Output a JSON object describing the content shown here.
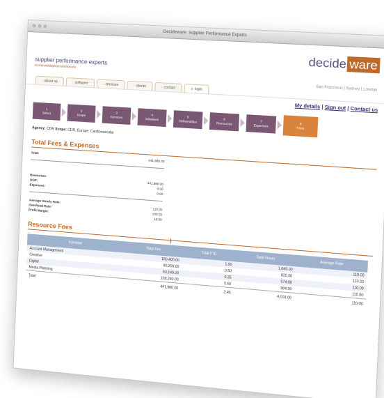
{
  "window": {
    "title": "Decideware: Supplier Performance Experts"
  },
  "brand": {
    "tagline": "supplier performance experts",
    "subtagline": "scorecard/deployment/service"
  },
  "logo": {
    "part1": "decide",
    "part2": "ware"
  },
  "cities": "San Francisco | Sydney | London",
  "nav": [
    {
      "label": "about us"
    },
    {
      "label": "software"
    },
    {
      "label": "services"
    },
    {
      "label": "clients"
    },
    {
      "label": "contact"
    },
    {
      "label": "login"
    }
  ],
  "user_links": {
    "details": "My details",
    "signout": "Sign out",
    "contact": "Contact us",
    "sep": "|"
  },
  "steps": [
    {
      "num": "1",
      "label": "Select"
    },
    {
      "num": "2",
      "label": "Scope"
    },
    {
      "num": "3",
      "label": "Services"
    },
    {
      "num": "4",
      "label": "Initiatives"
    },
    {
      "num": "5",
      "label": "Deliverables"
    },
    {
      "num": "6",
      "label": "Resources"
    },
    {
      "num": "7",
      "label": "Expenses"
    },
    {
      "num": "8",
      "label": "Fees"
    }
  ],
  "agency": {
    "agency_label": "Agency:",
    "agency": "CDR",
    "scope_label": "Scope:",
    "scope": "CDR, Europe, Cardiovascular"
  },
  "fees": {
    "heading": "Total Fees & Expenses",
    "total_label": "Total:",
    "total": "441,980.00",
    "resources_label": "Resources:",
    "resources": "441,980.00",
    "oop_label": "OOP:",
    "oop": "0.00",
    "expenses_label": "Expenses:",
    "expenses": "0.00",
    "avg_rate_label": "Average Hourly Rate:",
    "avg_rate": "110.00",
    "overhead_label": "Overhead Rate:",
    "overhead": "100.00",
    "margin_label": "Profit Margin:",
    "margin": "15.00"
  },
  "resource_fees": {
    "heading": "Resource Fees",
    "columns": [
      "Function",
      "Total Fee",
      "Total FTE",
      "Total Hours",
      "Average Rate"
    ],
    "rows": [
      [
        "Account Management",
        "180,400.00",
        "1.00",
        "1,640.00",
        "110.00"
      ],
      [
        "Creative",
        "90,200.00",
        "0.50",
        "820.00",
        "110.00"
      ],
      [
        "Digital",
        "63,140.00",
        "0.35",
        "574.00",
        "110.00"
      ],
      [
        "Media Planning",
        "108,240.00",
        "0.60",
        "984.00",
        "110.00"
      ]
    ],
    "total": [
      "Total",
      "441,980.00",
      "2.45",
      "4,018.00",
      "110.00"
    ]
  }
}
